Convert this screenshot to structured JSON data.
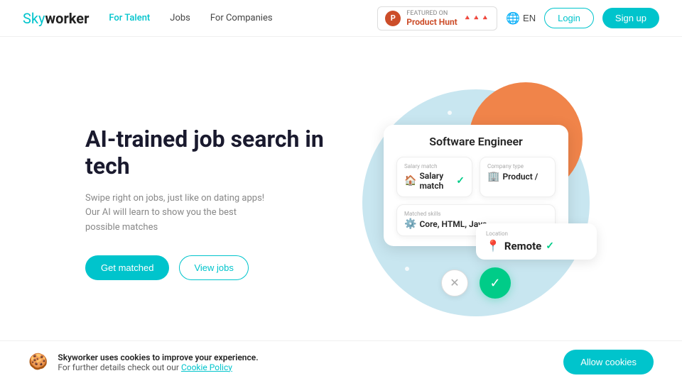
{
  "nav": {
    "logo_sky": "Sky",
    "logo_worker": "worker",
    "links": [
      {
        "label": "For Talent",
        "active": true
      },
      {
        "label": "Jobs",
        "active": false
      },
      {
        "label": "For Companies",
        "active": false
      }
    ],
    "product_hunt": {
      "featured": "FEATURED ON",
      "name": "Product Hunt",
      "cats": "🔺🔺🔺"
    },
    "lang": "EN",
    "login": "Login",
    "signup": "Sign up"
  },
  "hero": {
    "title": "AI-trained job search in tech",
    "subtitle": "Swipe right on jobs, just like on dating apps! Our AI will learn to show you the best possible matches",
    "btn_matched": "Get matched",
    "btn_jobs": "View jobs"
  },
  "job_card": {
    "title": "Software Engineer",
    "salary_label": "Salary match",
    "company_type_label": "Company type",
    "company_type_value": "Product /",
    "skills_label": "Matched skills",
    "skills_value": "Core, HTML, Java",
    "remote_label": "Location",
    "remote_value": "Remote"
  },
  "cookie": {
    "message_bold": "Skyworker uses cookies to improve your experience.",
    "message": "For further details check out our ",
    "link": "Cookie Policy",
    "btn": "Allow cookies"
  }
}
